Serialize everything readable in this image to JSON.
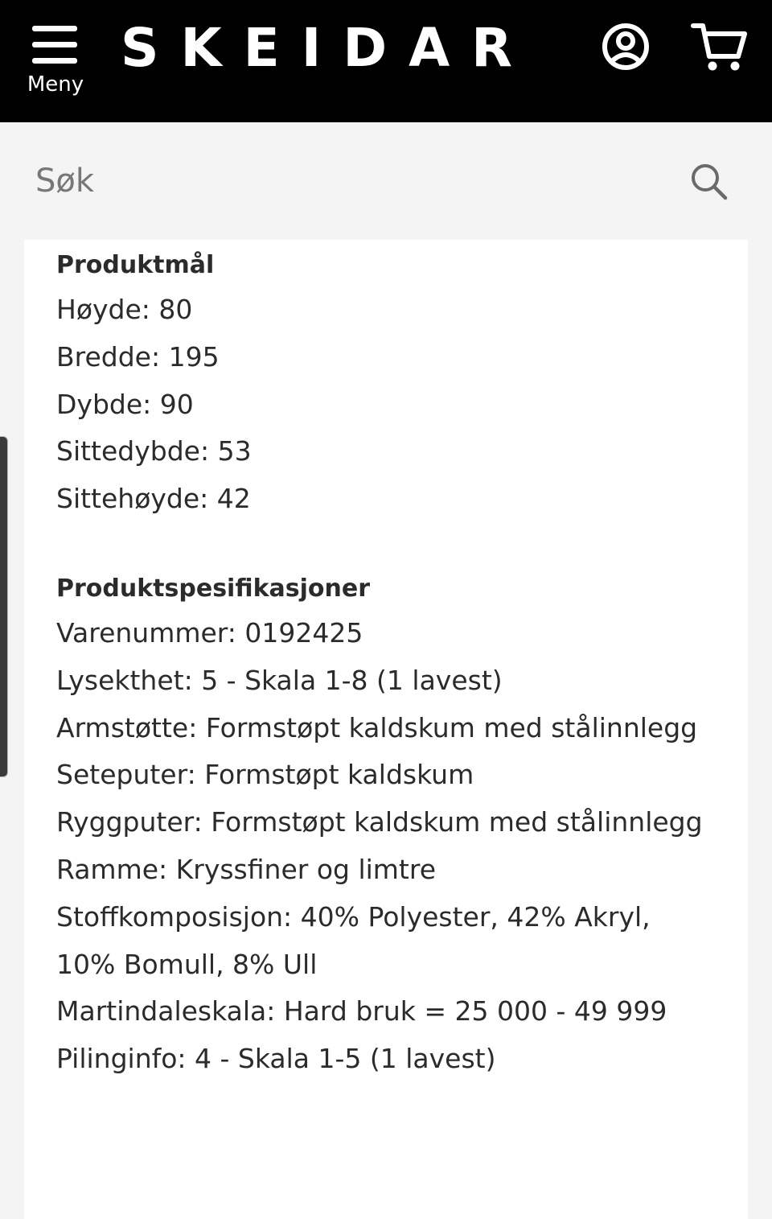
{
  "header": {
    "menu_label": "Meny",
    "logo_text": "SKEIDAR",
    "icons": {
      "menu": "hamburger-icon",
      "account": "user-icon",
      "cart": "cart-icon"
    }
  },
  "search": {
    "placeholder": "Søk",
    "icon": "search-icon"
  },
  "product_dimensions": {
    "title": "Produktmål",
    "lines": [
      "Høyde: 80",
      "Bredde: 195",
      "Dybde: 90",
      "Sittedybde: 53",
      "Sittehøyde: 42"
    ]
  },
  "product_specs": {
    "title": "Produktspesifikasjoner",
    "lines": [
      "Varenummer: 0192425",
      "Lysekthet: 5 - Skala 1-8 (1 lavest)",
      "Armstøtte: Formstøpt kaldskum med stålinnlegg",
      "Seteputer: Formstøpt kaldskum",
      "Ryggputer: Formstøpt kaldskum med stålinnlegg",
      "Ramme: Kryssfiner og limtre",
      "Stoffkomposisjon: 40% Polyester, 42% Akryl, 10% Bomull, 8% Ull",
      "Martindaleskala: Hard bruk = 25 000 - 49 999",
      "Pilinginfo: 4 - Skala 1-5 (1 lavest)"
    ]
  },
  "colors": {
    "header_bg": "#000000",
    "page_bg": "#f4f4f4",
    "card_bg": "#ffffff",
    "text": "#2b2b2b"
  }
}
